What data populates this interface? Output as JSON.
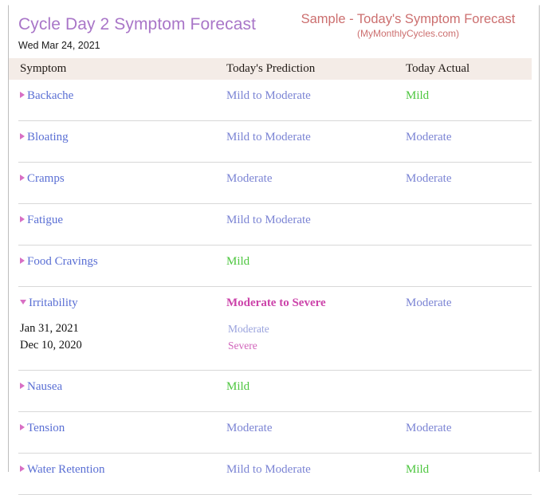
{
  "header": {
    "title": "Cycle Day 2 Symptom Forecast",
    "date": "Wed Mar 24, 2021",
    "sample_title": "Sample - Today's Symptom Forecast",
    "sample_source": "(MyMonthlyCycles.com)"
  },
  "colors": {
    "title": "#a976c8",
    "sample": "#cc6f6f",
    "header_band": "#f4ece7",
    "symptom_link": "#5a6fd4",
    "triangle": "#d86fc4",
    "mild": "#4dc63f",
    "moderate": "#7b84d4",
    "moderate_to_severe": "#cc44aa",
    "severe": "#d165bb",
    "divider": "#d8d8d8"
  },
  "table": {
    "columns": [
      "Symptom",
      "Today's Prediction",
      "Today Actual"
    ],
    "rows": [
      {
        "symptom": "Backache",
        "expanded": false,
        "prediction": "Mild to Moderate",
        "prediction_level": "mild-mod",
        "actual": "Mild",
        "actual_level": "mild",
        "history": []
      },
      {
        "symptom": "Bloating",
        "expanded": false,
        "prediction": "Mild to Moderate",
        "prediction_level": "mild-mod",
        "actual": "Moderate",
        "actual_level": "moderate",
        "history": []
      },
      {
        "symptom": "Cramps",
        "expanded": false,
        "prediction": "Moderate",
        "prediction_level": "moderate",
        "actual": "Moderate",
        "actual_level": "moderate",
        "history": []
      },
      {
        "symptom": "Fatigue",
        "expanded": false,
        "prediction": "Mild to Moderate",
        "prediction_level": "mild-mod",
        "actual": "",
        "actual_level": "none",
        "history": []
      },
      {
        "symptom": "Food Cravings",
        "expanded": false,
        "prediction": "Mild",
        "prediction_level": "mild",
        "actual": "",
        "actual_level": "none",
        "history": []
      },
      {
        "symptom": "Irritability",
        "expanded": true,
        "prediction": "Moderate to Severe",
        "prediction_level": "mod-sev",
        "actual": "Moderate",
        "actual_level": "moderate",
        "history": [
          {
            "date": "Jan 31, 2021",
            "value": "Moderate",
            "level": "moderate"
          },
          {
            "date": "Dec 10, 2020",
            "value": "Severe",
            "level": "severe"
          }
        ]
      },
      {
        "symptom": "Nausea",
        "expanded": false,
        "prediction": "Mild",
        "prediction_level": "mild",
        "actual": "",
        "actual_level": "none",
        "history": []
      },
      {
        "symptom": "Tension",
        "expanded": false,
        "prediction": "Moderate",
        "prediction_level": "moderate",
        "actual": "Moderate",
        "actual_level": "moderate",
        "history": []
      },
      {
        "symptom": "Water Retention",
        "expanded": false,
        "prediction": "Mild to Moderate",
        "prediction_level": "mild-mod",
        "actual": "Mild",
        "actual_level": "mild",
        "history": []
      }
    ]
  }
}
